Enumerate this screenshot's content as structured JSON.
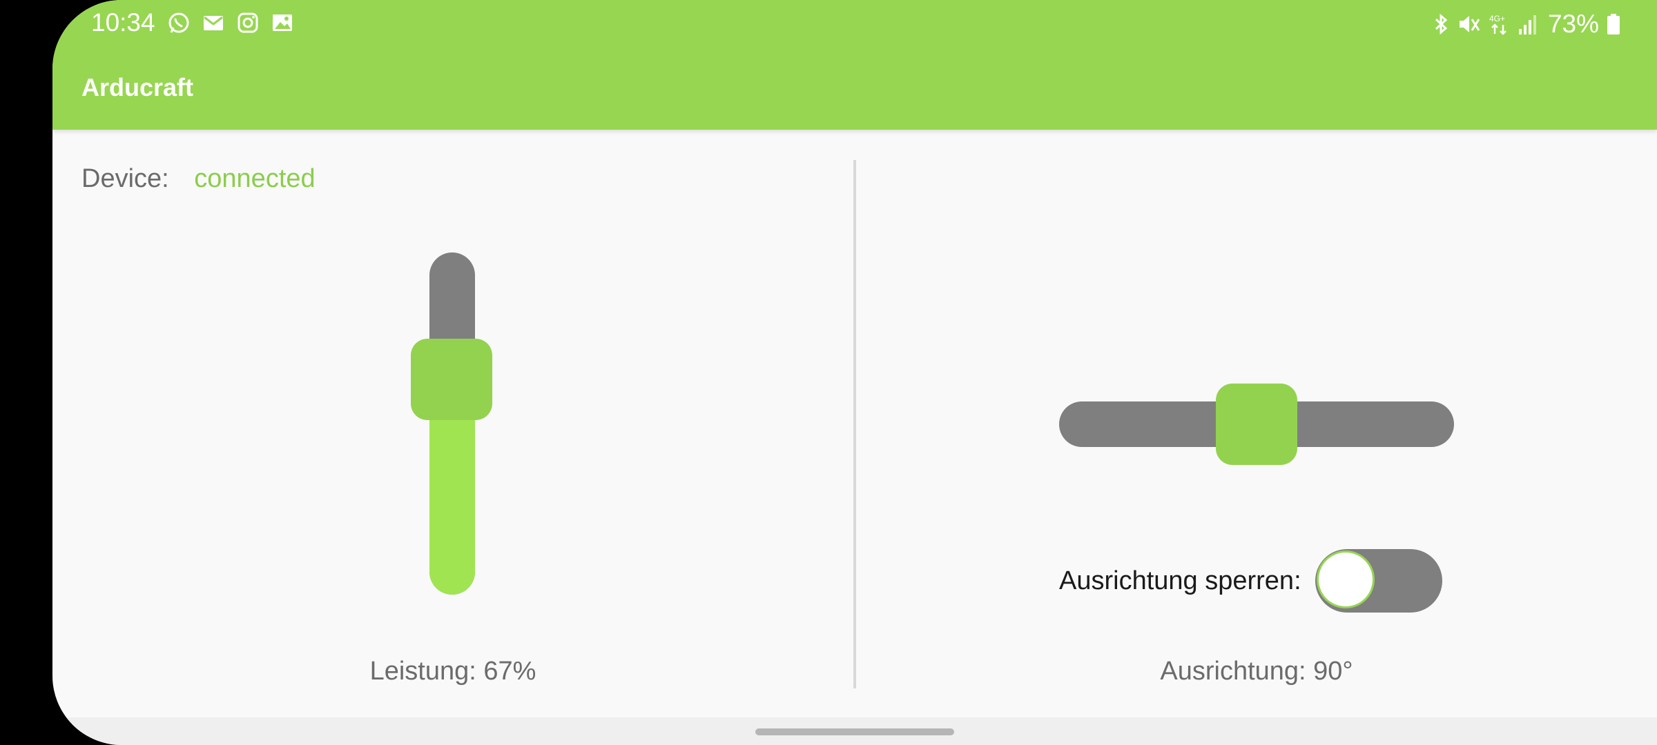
{
  "status_bar": {
    "time": "10:34",
    "left_icons": [
      "whatsapp-icon",
      "email-icon",
      "instagram-icon",
      "gallery-icon"
    ],
    "right_icons": [
      "bluetooth-icon",
      "mute-icon",
      "network-4g-icon",
      "signal-icon"
    ],
    "battery": "73%"
  },
  "app_bar": {
    "title": "Arducraft"
  },
  "device": {
    "label": "Device:",
    "status": "connected"
  },
  "power": {
    "label": "Leistung: 67%",
    "value": 0.67
  },
  "orientation": {
    "lock_label": "Ausrichtung sperren:",
    "lock_enabled": false,
    "label": "Ausrichtung: 90°",
    "value_degrees": 90,
    "range_degrees": [
      0,
      180
    ]
  },
  "colors": {
    "accent": "#97d651",
    "track": "#7f7f7f",
    "fill": "#a1e452",
    "thumb": "#93d24f"
  }
}
